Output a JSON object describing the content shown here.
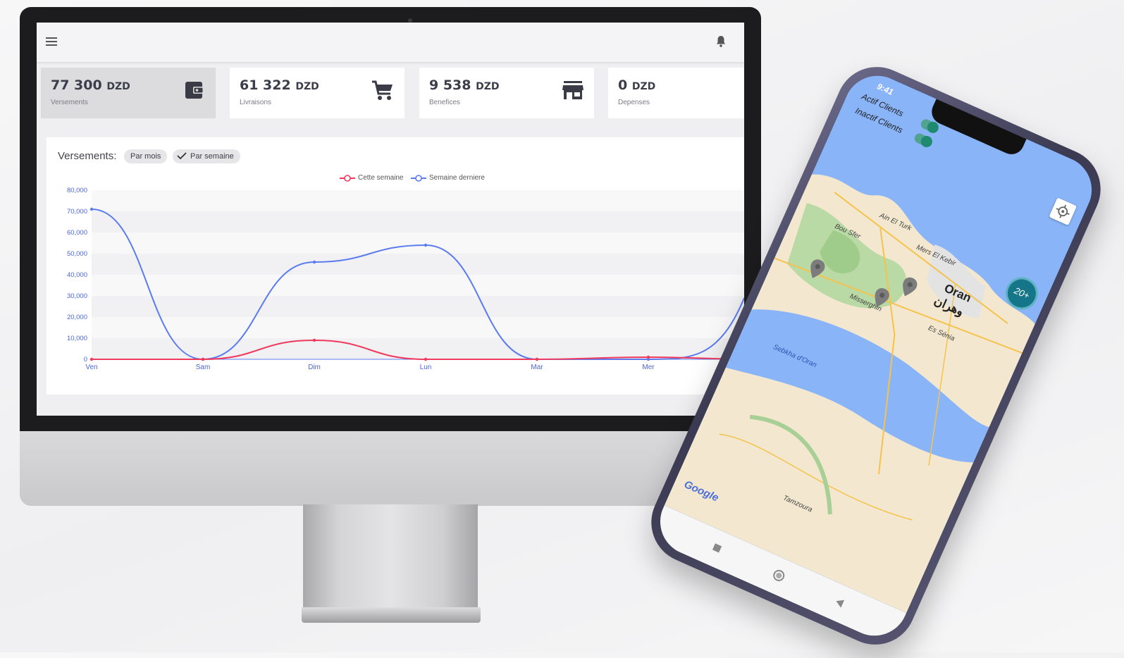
{
  "desktop": {
    "stats": [
      {
        "value": "77 300",
        "unit": "DZD",
        "label": "Versements",
        "icon": "wallet-icon",
        "active": true
      },
      {
        "value": "61 322",
        "unit": "DZD",
        "label": "Livraisons",
        "icon": "cart-icon",
        "active": false
      },
      {
        "value": "9 538",
        "unit": "DZD",
        "label": "Benefices",
        "icon": "store-icon",
        "active": false
      },
      {
        "value": "0",
        "unit": "DZD",
        "label": "Depenses",
        "icon": "",
        "active": false
      }
    ],
    "chart_panel": {
      "title": "Versements:",
      "chips": [
        {
          "label": "Par mois",
          "checked": false
        },
        {
          "label": "Par semaine",
          "checked": true
        }
      ]
    }
  },
  "chart_data": {
    "type": "line",
    "categories": [
      "Ven",
      "Sam",
      "Dim",
      "Lun",
      "Mar",
      "Mer"
    ],
    "series": [
      {
        "name": "Cette semaine",
        "color": "#ef3a5d",
        "values": [
          0,
          0,
          9000,
          0,
          0,
          1000
        ]
      },
      {
        "name": "Semaine derniere",
        "color": "#5b7cf0",
        "values": [
          71000,
          0,
          46000,
          54000,
          0,
          0
        ]
      }
    ],
    "y_ticks": [
      "80,000",
      "70,000",
      "60,000",
      "50,000",
      "40,000",
      "30,000",
      "20,000",
      "10,000",
      "0"
    ],
    "ylim": [
      0,
      80000
    ],
    "legend_position": "top-center",
    "grid": true
  },
  "phone": {
    "status_time": "9:41",
    "filters": [
      {
        "label": "Actif Clients",
        "on": true
      },
      {
        "label": "Inactif Clients",
        "on": true
      }
    ],
    "map": {
      "places": [
        "Ain El Turk",
        "Mers El Kebir",
        "Bou Sfer",
        "Oran",
        "وهران",
        "Misserghin",
        "Es Sénia",
        "Sebkha d'Oran",
        "Tamzoura"
      ],
      "cluster_label": "20+",
      "attribution": "Google"
    }
  }
}
